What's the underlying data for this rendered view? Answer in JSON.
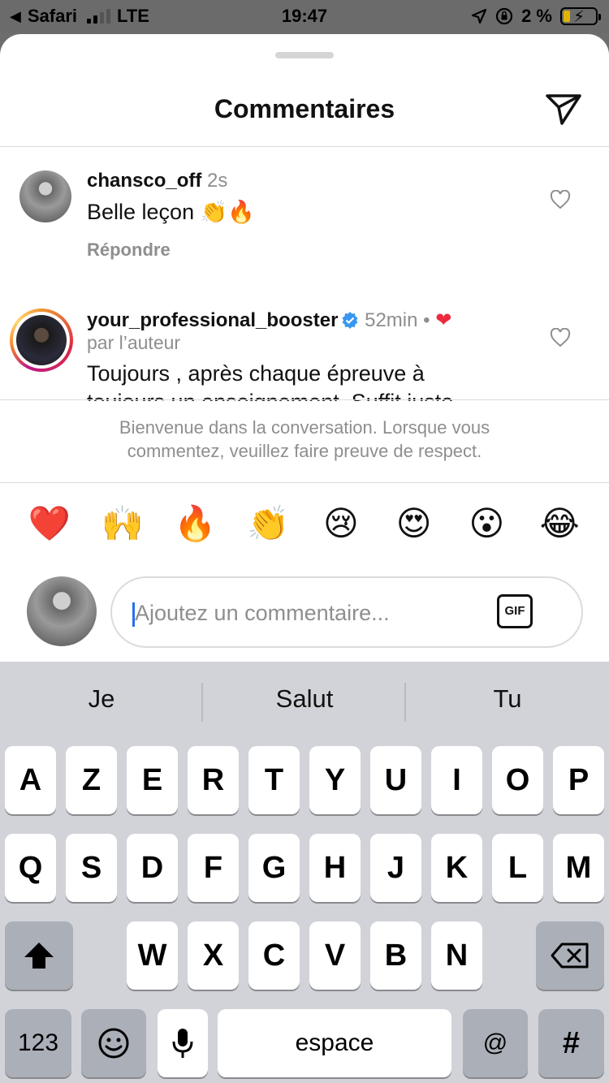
{
  "status_bar": {
    "back_app": "Safari",
    "network": "LTE",
    "time": "19:47",
    "battery_percent": "2 %",
    "battery_level": 0.02
  },
  "header": {
    "title": "Commentaires",
    "send_icon": "paper-plane-icon"
  },
  "comments": [
    {
      "username": "chansco_off",
      "time": "2s",
      "text": "Belle leçon 👏🔥",
      "reply_label": "Répondre",
      "like_icon": "heart-outline-icon"
    },
    {
      "username": "your_professional_booster",
      "verified": true,
      "time": "52min",
      "separator": "•",
      "liked_by_author": true,
      "author_label": "par l’auteur",
      "text": "Toujours , après chaque épreuve à",
      "text_cut": "toujours un enseignement. Suffit juste",
      "like_icon": "heart-outline-icon"
    }
  ],
  "welcome": {
    "line1": "Bienvenue dans la conversation. Lorsque vous",
    "line2": "commentez, veuillez faire preuve de respect."
  },
  "quick_emojis": [
    "❤️",
    "🙌",
    "🔥",
    "👏",
    "😢",
    "😍",
    "😮",
    "😂"
  ],
  "composer": {
    "placeholder": "Ajoutez un commentaire...",
    "gif_label": "GIF"
  },
  "keyboard": {
    "suggestions": [
      "Je",
      "Salut",
      "Tu"
    ],
    "row1": [
      "A",
      "Z",
      "E",
      "R",
      "T",
      "Y",
      "U",
      "I",
      "O",
      "P"
    ],
    "row2": [
      "Q",
      "S",
      "D",
      "F",
      "G",
      "H",
      "J",
      "K",
      "L",
      "M"
    ],
    "row3": [
      "W",
      "X",
      "C",
      "V",
      "B",
      "N"
    ],
    "numbers_label": "123",
    "space_label": "espace",
    "at_label": "@",
    "hash_label": "#"
  },
  "colors": {
    "verified_blue": "#3897f0",
    "like_red": "#ed2a3d",
    "caret_blue": "#2b6ef0"
  }
}
